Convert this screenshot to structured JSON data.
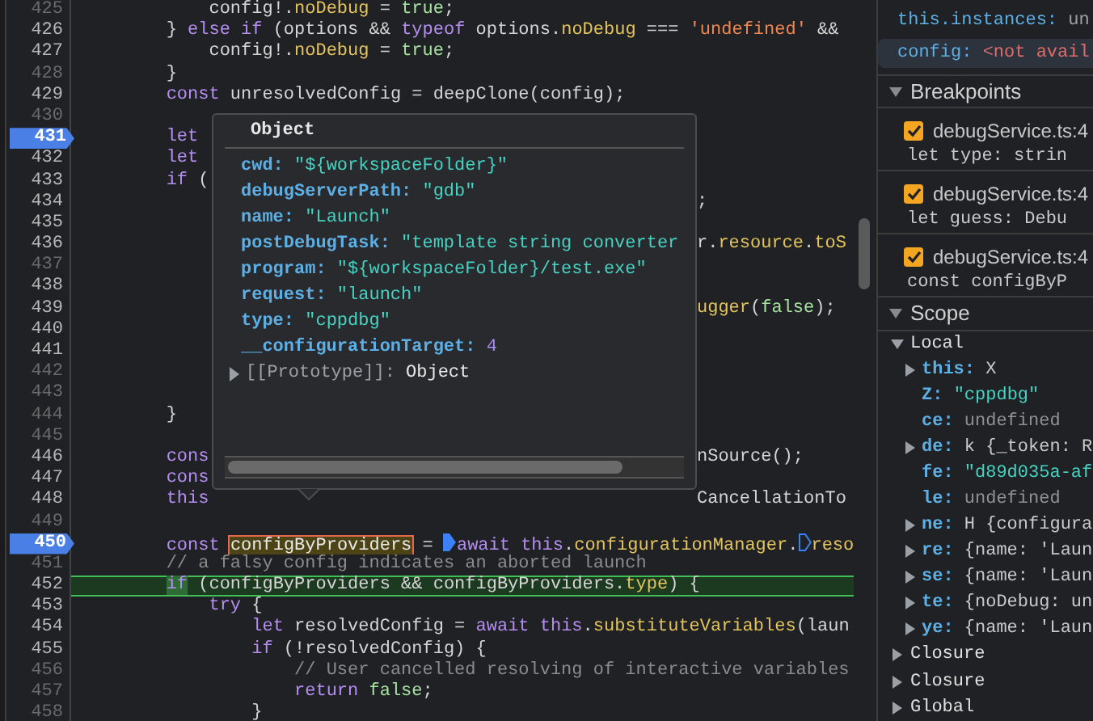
{
  "editor": {
    "lines": [
      {
        "number": "425",
        "dim": true,
        "breakpoint": false,
        "current": false,
        "segments": [
          {
            "text": "            config!.",
            "kind": "plain"
          },
          {
            "text": "noDebug",
            "kind": "prop"
          },
          {
            "text": " = ",
            "kind": "plain"
          },
          {
            "text": "true",
            "kind": "bool"
          },
          {
            "text": ";",
            "kind": "plain"
          }
        ]
      },
      {
        "number": "426",
        "dim": false,
        "breakpoint": false,
        "current": false,
        "segments": [
          {
            "text": "        } ",
            "kind": "plain"
          },
          {
            "text": "else if",
            "kind": "kw"
          },
          {
            "text": " (options && ",
            "kind": "plain"
          },
          {
            "text": "typeof",
            "kind": "kw"
          },
          {
            "text": " options.",
            "kind": "plain"
          },
          {
            "text": "noDebug",
            "kind": "prop"
          },
          {
            "text": " === ",
            "kind": "plain"
          },
          {
            "text": "'undefined'",
            "kind": "str"
          },
          {
            "text": " &&",
            "kind": "plain"
          }
        ]
      },
      {
        "number": "427",
        "dim": false,
        "breakpoint": false,
        "current": false,
        "segments": [
          {
            "text": "            config!.",
            "kind": "plain"
          },
          {
            "text": "noDebug",
            "kind": "prop"
          },
          {
            "text": " = ",
            "kind": "plain"
          },
          {
            "text": "true",
            "kind": "bool"
          },
          {
            "text": ";",
            "kind": "plain"
          }
        ]
      },
      {
        "number": "428",
        "dim": true,
        "breakpoint": false,
        "current": false,
        "segments": [
          {
            "text": "        }",
            "kind": "plain"
          }
        ]
      },
      {
        "number": "429",
        "dim": false,
        "breakpoint": false,
        "current": false,
        "segments": [
          {
            "text": "        const",
            "kind": "kw"
          },
          {
            "text": " unresolvedConfig = deepClone(config);",
            "kind": "plain"
          }
        ]
      },
      {
        "number": "430",
        "dim": true,
        "breakpoint": false,
        "current": false
      },
      {
        "number": "431",
        "dim": false,
        "breakpoint": true,
        "current": false,
        "segments": [
          {
            "text": "        let",
            "kind": "kw"
          }
        ]
      },
      {
        "number": "432",
        "dim": false,
        "breakpoint": false,
        "current": false,
        "segments": [
          {
            "text": "        let",
            "kind": "kw"
          }
        ]
      },
      {
        "number": "433",
        "dim": false,
        "breakpoint": false,
        "current": false,
        "segments": [
          {
            "text": "        if",
            "kind": "kw"
          },
          {
            "text": " (",
            "kind": "plain"
          }
        ]
      },
      {
        "number": "434",
        "dim": false,
        "breakpoint": false,
        "current": false,
        "right": [
          {
            "text": ";",
            "kind": "plain"
          }
        ]
      },
      {
        "number": "435",
        "dim": false,
        "breakpoint": false,
        "current": false
      },
      {
        "number": "436",
        "dim": false,
        "breakpoint": false,
        "current": false,
        "right": [
          {
            "text": "r.",
            "kind": "plain"
          },
          {
            "text": "resource",
            "kind": "prop"
          },
          {
            "text": ".",
            "kind": "plain"
          },
          {
            "text": "toS",
            "kind": "prop"
          }
        ]
      },
      {
        "number": "437",
        "dim": true,
        "breakpoint": false,
        "current": false
      },
      {
        "number": "438",
        "dim": false,
        "breakpoint": false,
        "current": false
      },
      {
        "number": "439",
        "dim": false,
        "breakpoint": false,
        "current": false,
        "right": [
          {
            "text": "ugger",
            "kind": "prop"
          },
          {
            "text": "(",
            "kind": "plain"
          },
          {
            "text": "false",
            "kind": "bool"
          },
          {
            "text": ");",
            "kind": "plain"
          }
        ]
      },
      {
        "number": "440",
        "dim": false,
        "breakpoint": false,
        "current": false
      },
      {
        "number": "441",
        "dim": false,
        "breakpoint": false,
        "current": false
      },
      {
        "number": "442",
        "dim": true,
        "breakpoint": false,
        "current": false
      },
      {
        "number": "443",
        "dim": true,
        "breakpoint": false,
        "current": false
      },
      {
        "number": "444",
        "dim": true,
        "breakpoint": false,
        "current": false,
        "segments": [
          {
            "text": "        }",
            "kind": "plain"
          }
        ]
      },
      {
        "number": "445",
        "dim": true,
        "breakpoint": false,
        "current": false
      },
      {
        "number": "446",
        "dim": false,
        "breakpoint": false,
        "current": false,
        "segments": [
          {
            "text": "        cons",
            "kind": "kw"
          }
        ],
        "right": [
          {
            "text": "nSource();",
            "kind": "plain"
          }
        ]
      },
      {
        "number": "447",
        "dim": false,
        "breakpoint": false,
        "current": false,
        "segments": [
          {
            "text": "        cons",
            "kind": "kw"
          }
        ]
      },
      {
        "number": "448",
        "dim": false,
        "breakpoint": false,
        "current": false,
        "segments": [
          {
            "text": "        this",
            "kind": "kw"
          }
        ],
        "right": [
          {
            "text": "CancellationTo",
            "kind": "plain"
          }
        ]
      },
      {
        "number": "449",
        "dim": true,
        "breakpoint": false,
        "current": false
      },
      {
        "number": "450",
        "dim": false,
        "breakpoint": true,
        "current": false,
        "segments": [
          {
            "text": "        const",
            "kind": "kw"
          },
          {
            "text": "configByProviders",
            "kind": "hover"
          },
          {
            "text": " = ",
            "kind": "plain"
          },
          {
            "kind": "marker",
            "active": true
          },
          {
            "text": "await this",
            "kind": "kw"
          },
          {
            "text": ".",
            "kind": "plain"
          },
          {
            "text": "configurationManager",
            "kind": "prop"
          },
          {
            "text": ".",
            "kind": "plain"
          },
          {
            "kind": "marker",
            "active": false
          },
          {
            "text": "reso",
            "kind": "prop"
          }
        ]
      },
      {
        "number": "451",
        "dim": true,
        "breakpoint": false,
        "current": false,
        "segments": [
          {
            "text": "        // a falsy config indicates an aborted launch",
            "kind": "comment"
          }
        ]
      },
      {
        "number": "452",
        "dim": false,
        "breakpoint": false,
        "current": true,
        "segments": [
          {
            "text": "        if",
            "kind": "kw"
          },
          {
            "text": " (configByProviders && configByProviders.",
            "kind": "plain"
          },
          {
            "text": "type",
            "kind": "prop"
          },
          {
            "text": ") {",
            "kind": "plain"
          }
        ]
      },
      {
        "number": "453",
        "dim": false,
        "breakpoint": false,
        "current": false,
        "segments": [
          {
            "text": "            try",
            "kind": "kw"
          },
          {
            "text": " {",
            "kind": "plain"
          }
        ]
      },
      {
        "number": "454",
        "dim": false,
        "breakpoint": false,
        "current": false,
        "segments": [
          {
            "text": "                let",
            "kind": "kw"
          },
          {
            "text": " resolvedConfig = ",
            "kind": "plain"
          },
          {
            "text": "await this",
            "kind": "kw"
          },
          {
            "text": ".",
            "kind": "plain"
          },
          {
            "text": "substituteVariables",
            "kind": "prop"
          },
          {
            "text": "(laun",
            "kind": "plain"
          }
        ]
      },
      {
        "number": "455",
        "dim": false,
        "breakpoint": false,
        "current": false,
        "segments": [
          {
            "text": "                if",
            "kind": "kw"
          },
          {
            "text": " (!resolvedConfig) {",
            "kind": "plain"
          }
        ]
      },
      {
        "number": "456",
        "dim": true,
        "breakpoint": false,
        "current": false,
        "segments": [
          {
            "text": "                    // User cancelled resolving of interactive variables",
            "kind": "comment"
          }
        ]
      },
      {
        "number": "457",
        "dim": true,
        "breakpoint": false,
        "current": false,
        "segments": [
          {
            "text": "                    return",
            "kind": "kw"
          },
          {
            "text": " false",
            "kind": "bool"
          },
          {
            "text": ";",
            "kind": "plain"
          }
        ]
      },
      {
        "number": "458",
        "dim": true,
        "breakpoint": false,
        "current": false,
        "segments": [
          {
            "text": "                }",
            "kind": "plain"
          }
        ]
      }
    ]
  },
  "popover": {
    "title": "Object",
    "properties": [
      {
        "name": "cwd:",
        "value": "\"${workspaceFolder}\"",
        "kind": "string"
      },
      {
        "name": "debugServerPath:",
        "value": "\"gdb\"",
        "kind": "string"
      },
      {
        "name": "name:",
        "value": "\"Launch\"",
        "kind": "string"
      },
      {
        "name": "postDebugTask:",
        "value": "\"template string converter",
        "kind": "string"
      },
      {
        "name": "program:",
        "value": "\"${workspaceFolder}/test.exe\"",
        "kind": "string"
      },
      {
        "name": "request:",
        "value": "\"launch\"",
        "kind": "string"
      },
      {
        "name": "type:",
        "value": "\"cppdbg\"",
        "kind": "string"
      },
      {
        "name": "__configurationTarget:",
        "value": "4",
        "kind": "number"
      }
    ],
    "prototype": {
      "name": "[[Prototype]]:",
      "value": "Object",
      "expanded": false
    }
  },
  "sidebar": {
    "watch": [
      {
        "name": "this.instances:",
        "value": "un",
        "kind": "undefined",
        "selected": false
      },
      {
        "name": "config:",
        "value": "<not avail",
        "kind": "error",
        "selected": true
      }
    ],
    "breakpoints": {
      "title": "Breakpoints",
      "expanded": true,
      "items": [
        {
          "file": "debugService.ts:4",
          "code": "let type: strin",
          "checked": true
        },
        {
          "file": "debugService.ts:4",
          "code": "let guess: Debu",
          "checked": true
        },
        {
          "file": "debugService.ts:4",
          "code": "const configByP",
          "checked": true
        }
      ]
    },
    "scope": {
      "title": "Scope",
      "expanded": true,
      "groups": [
        {
          "name": "Local",
          "expanded": true,
          "variables": [
            {
              "name": "this:",
              "value": "X",
              "kind": "object",
              "expandable": true
            },
            {
              "name": "Z:",
              "value": "\"cppdbg\"",
              "kind": "string",
              "expandable": false
            },
            {
              "name": "ce:",
              "value": "undefined",
              "kind": "undefined",
              "expandable": false
            },
            {
              "name": "de:",
              "value": "k {_token: R",
              "kind": "object",
              "expandable": true
            },
            {
              "name": "fe:",
              "value": "\"d89d035a-af",
              "kind": "string",
              "expandable": false
            },
            {
              "name": "le:",
              "value": "undefined",
              "kind": "undefined",
              "expandable": false
            },
            {
              "name": "ne:",
              "value": "H {configura",
              "kind": "object",
              "expandable": true
            },
            {
              "name": "re:",
              "value": "{name: 'Laun",
              "kind": "object",
              "expandable": true
            },
            {
              "name": "se:",
              "value": "{name: 'Laun",
              "kind": "object",
              "expandable": true
            },
            {
              "name": "te:",
              "value": "{noDebug: un",
              "kind": "object",
              "expandable": true
            },
            {
              "name": "ye:",
              "value": "{name: 'Laun",
              "kind": "object",
              "expandable": true
            }
          ]
        },
        {
          "name": "Closure",
          "expanded": false
        },
        {
          "name": "Closure",
          "expanded": false
        },
        {
          "name": "Global",
          "expanded": false
        }
      ]
    }
  }
}
